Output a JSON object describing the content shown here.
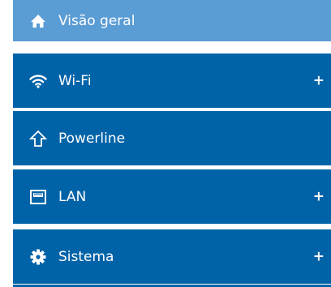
{
  "menu": {
    "items": [
      {
        "label": "Visão geral",
        "icon": "home-icon",
        "active": true,
        "expandable": false
      },
      {
        "label": "Wi-Fi",
        "icon": "wifi-icon",
        "active": false,
        "expandable": true,
        "expand_symbol": "+"
      },
      {
        "label": "Powerline",
        "icon": "powerline-icon",
        "active": false,
        "expandable": false
      },
      {
        "label": "LAN",
        "icon": "lan-port-icon",
        "active": false,
        "expandable": true,
        "expand_symbol": "+"
      },
      {
        "label": "Sistema",
        "icon": "gear-icon",
        "active": false,
        "expandable": true,
        "expand_symbol": "+"
      }
    ]
  },
  "colors": {
    "item_background": "#0063a8",
    "active_background": "#5a9cd4",
    "text": "#ffffff"
  }
}
